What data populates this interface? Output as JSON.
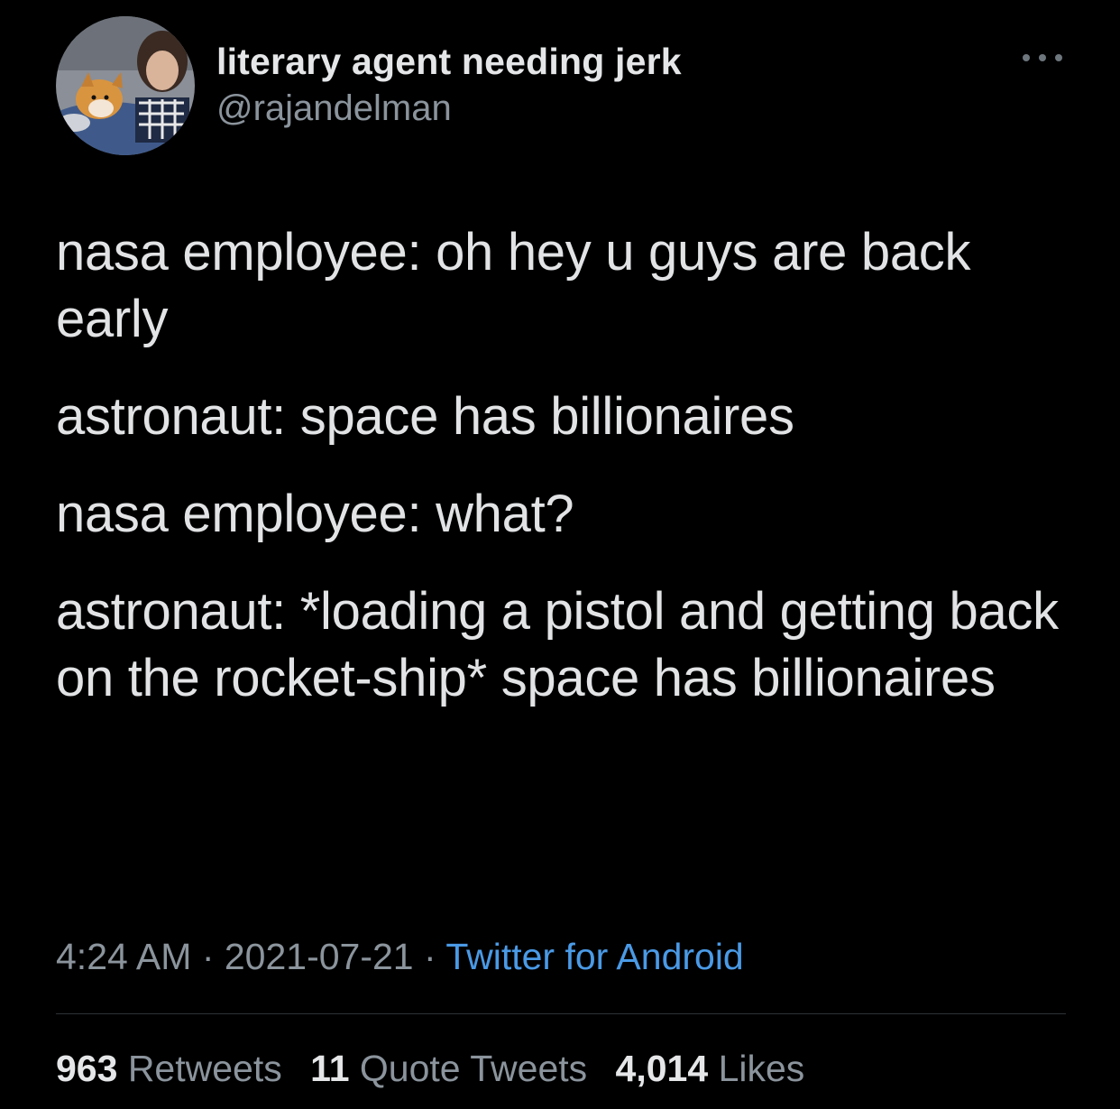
{
  "author": {
    "display_name": "literary agent needing jerk",
    "handle": "@rajandelman"
  },
  "more_icon": "more-horizontal-icon",
  "tweet": {
    "lines": [
      "nasa employee: oh hey u guys are back early",
      "astronaut: space has billionaires",
      "nasa employee: what?",
      "astronaut: *loading a pistol and getting back on the rocket-ship* space has billionaires"
    ]
  },
  "meta": {
    "time": "4:24 AM",
    "separator": " · ",
    "date": "2021-07-21",
    "source": "Twitter for Android"
  },
  "stats": {
    "retweets": {
      "count": "963",
      "label": "Retweets"
    },
    "quotes": {
      "count": "11",
      "label": "Quote Tweets"
    },
    "likes": {
      "count": "4,014",
      "label": "Likes"
    }
  },
  "colors": {
    "background": "#000000",
    "text": "#e1e3e5",
    "secondary": "#8b949c",
    "link": "#4a9ae6",
    "divider": "#2f3336"
  }
}
